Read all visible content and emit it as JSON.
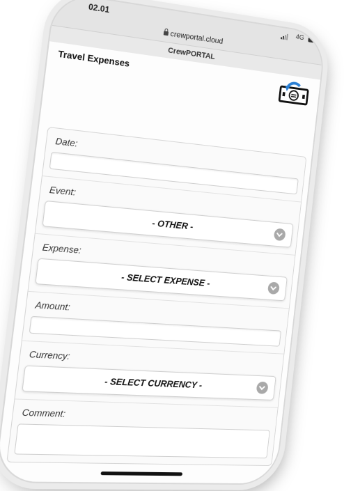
{
  "status_bar": {
    "time": "02.01",
    "network": "4G"
  },
  "browser": {
    "url": "crewportal.cloud"
  },
  "app": {
    "title": "CrewPORTAL"
  },
  "page": {
    "title": "Travel Expenses"
  },
  "icons": {
    "expense": "money-refund-icon",
    "lock": "lock-icon",
    "chevron": "chevron-down-icon"
  },
  "form": {
    "date": {
      "label": "Date:",
      "value": ""
    },
    "event": {
      "label": "Event:",
      "selected": "- OTHER -"
    },
    "expense": {
      "label": "Expense:",
      "selected": "- SELECT EXPENSE -"
    },
    "amount": {
      "label": "Amount:",
      "value": ""
    },
    "currency": {
      "label": "Currency:",
      "selected": "- SELECT CURRENCY -"
    },
    "comment": {
      "label": "Comment:",
      "value": ""
    }
  },
  "colors": {
    "accent": "#2a7fd4",
    "chevron": "#a9a9a9"
  }
}
